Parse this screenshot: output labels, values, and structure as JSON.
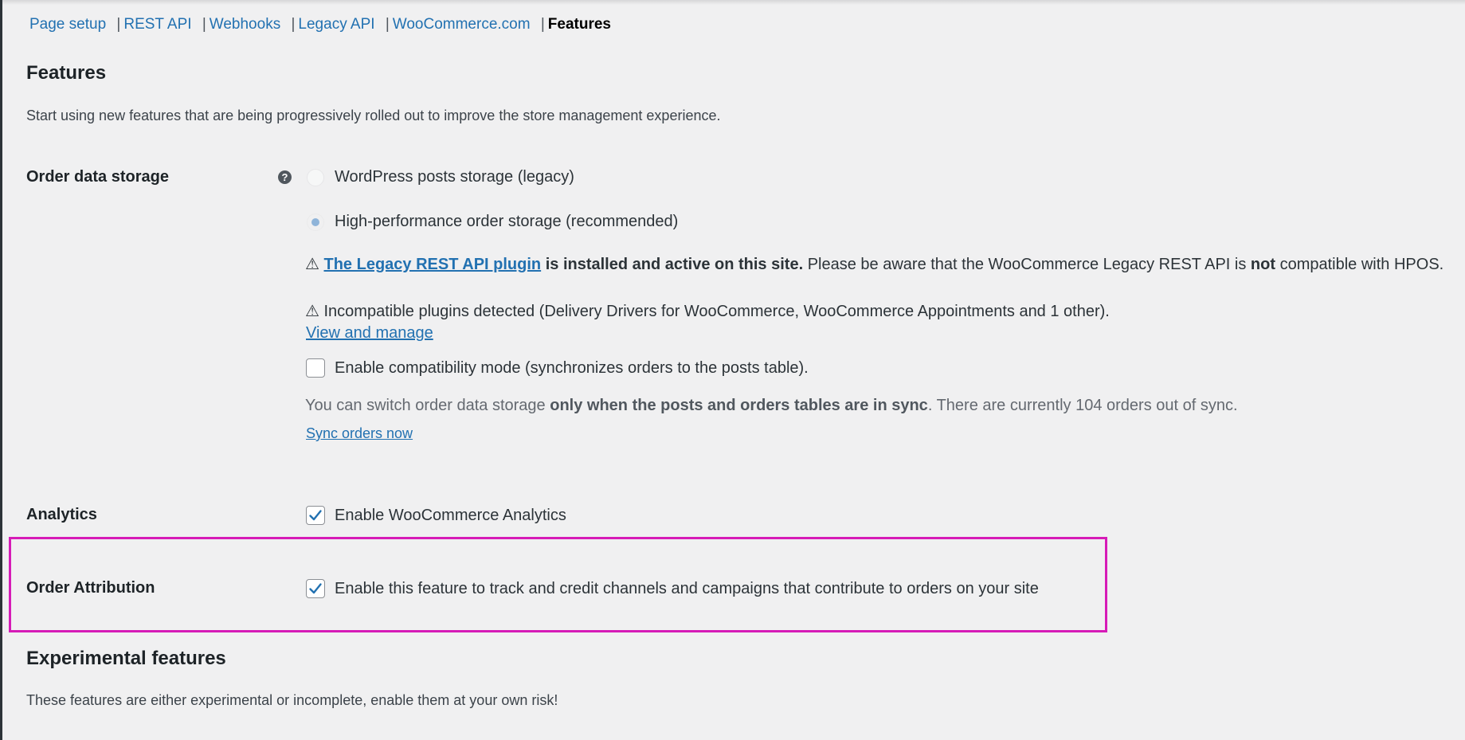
{
  "subnav": {
    "items": [
      {
        "label": "Page setup",
        "current": false
      },
      {
        "label": "REST API",
        "current": false
      },
      {
        "label": "Webhooks",
        "current": false
      },
      {
        "label": "Legacy API",
        "current": false
      },
      {
        "label": "WooCommerce.com",
        "current": false
      },
      {
        "label": "Features",
        "current": true
      }
    ],
    "separator": "|"
  },
  "features": {
    "title": "Features",
    "description": "Start using new features that are being progressively rolled out to improve the store management experience."
  },
  "order_data_storage": {
    "label": "Order data storage",
    "help_icon": "?",
    "options": [
      {
        "label": "WordPress posts storage (legacy)",
        "selected": false
      },
      {
        "label": "High-performance order storage (recommended)",
        "selected": true
      }
    ],
    "legacy_notice": {
      "icon": "⚠",
      "link_text": "The Legacy REST API plugin",
      "bold_text": "is installed and active on this site.",
      "text_before_not": "Please be aware that the WooCommerce Legacy REST API is",
      "not_text": "not",
      "text_after_not": "compatible with HPOS."
    },
    "incompatible_notice": {
      "icon": "⚠",
      "text": "Incompatible plugins detected (Delivery Drivers for WooCommerce, WooCommerce Appointments and 1 other).",
      "link_text": "View and manage"
    },
    "compat_mode": {
      "label": "Enable compatibility mode (synchronizes orders to the posts table).",
      "checked": false
    },
    "sync_note": {
      "before": "You can switch order data storage",
      "bold": "only when the posts and orders tables are in sync",
      "after": ". There are currently 104 orders out of sync."
    },
    "sync_link": "Sync orders now"
  },
  "analytics": {
    "label": "Analytics",
    "checkbox_label": "Enable WooCommerce Analytics",
    "checked": true
  },
  "order_attribution": {
    "label": "Order Attribution",
    "checkbox_label": "Enable this feature to track and credit channels and campaigns that contribute to orders on your site",
    "checked": true
  },
  "experimental": {
    "title": "Experimental features",
    "description": "These features are either experimental or incomplete, enable them at your own risk!"
  },
  "colors": {
    "link": "#2271b1",
    "background": "#f0f0f1",
    "highlight_box": "#d61bb7",
    "checkmark": "#2271b1"
  }
}
